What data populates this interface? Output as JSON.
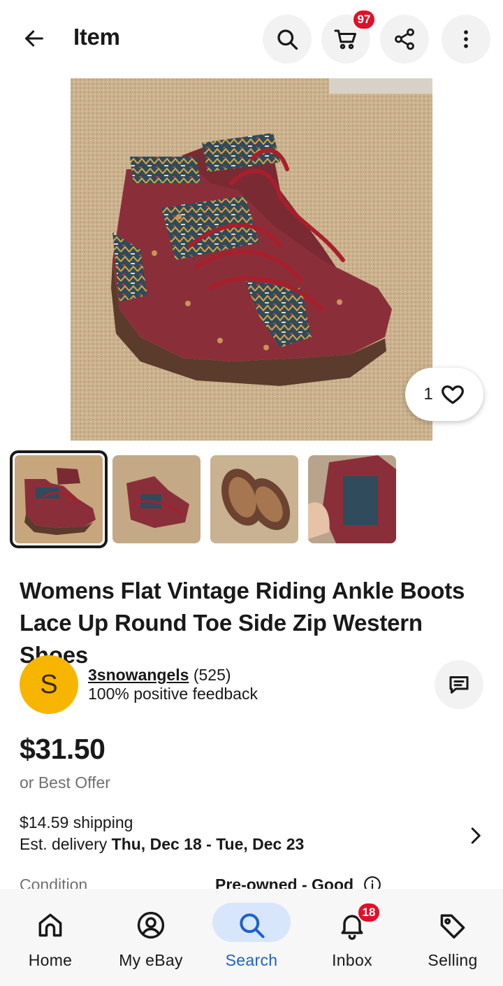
{
  "header": {
    "title": "Item",
    "cart_count": "97"
  },
  "listing": {
    "watch_count": "1",
    "title": "Womens Flat Vintage Riding Ankle Boots Lace Up Round Toe Side Zip Western Shoes",
    "price": "$31.50",
    "best_offer": "or Best Offer",
    "shipping": "$14.59 shipping",
    "delivery_prefix": "Est. delivery ",
    "delivery_dates": "Thu, Dec 18 - Tue, Dec 23",
    "condition_label": "Condition",
    "condition_value": "Pre-owned - Good",
    "thumbnail_count": 4,
    "selected_thumbnail": 1
  },
  "seller": {
    "initial": "S",
    "name": "3snowangels",
    "score": "(525)",
    "feedback": "100% positive feedback",
    "avatar_color": "#f7b500"
  },
  "bottom_nav": {
    "items": [
      {
        "label": "Home",
        "icon": "home-icon"
      },
      {
        "label": "My eBay",
        "icon": "profile-icon"
      },
      {
        "label": "Search",
        "icon": "search-icon",
        "active": true
      },
      {
        "label": "Inbox",
        "icon": "bell-icon",
        "badge": "18"
      },
      {
        "label": "Selling",
        "icon": "tag-icon"
      }
    ]
  },
  "colors": {
    "accent_blue": "#1d62c9",
    "badge_red": "#e0102a",
    "active_pill": "#d7e6fb"
  }
}
